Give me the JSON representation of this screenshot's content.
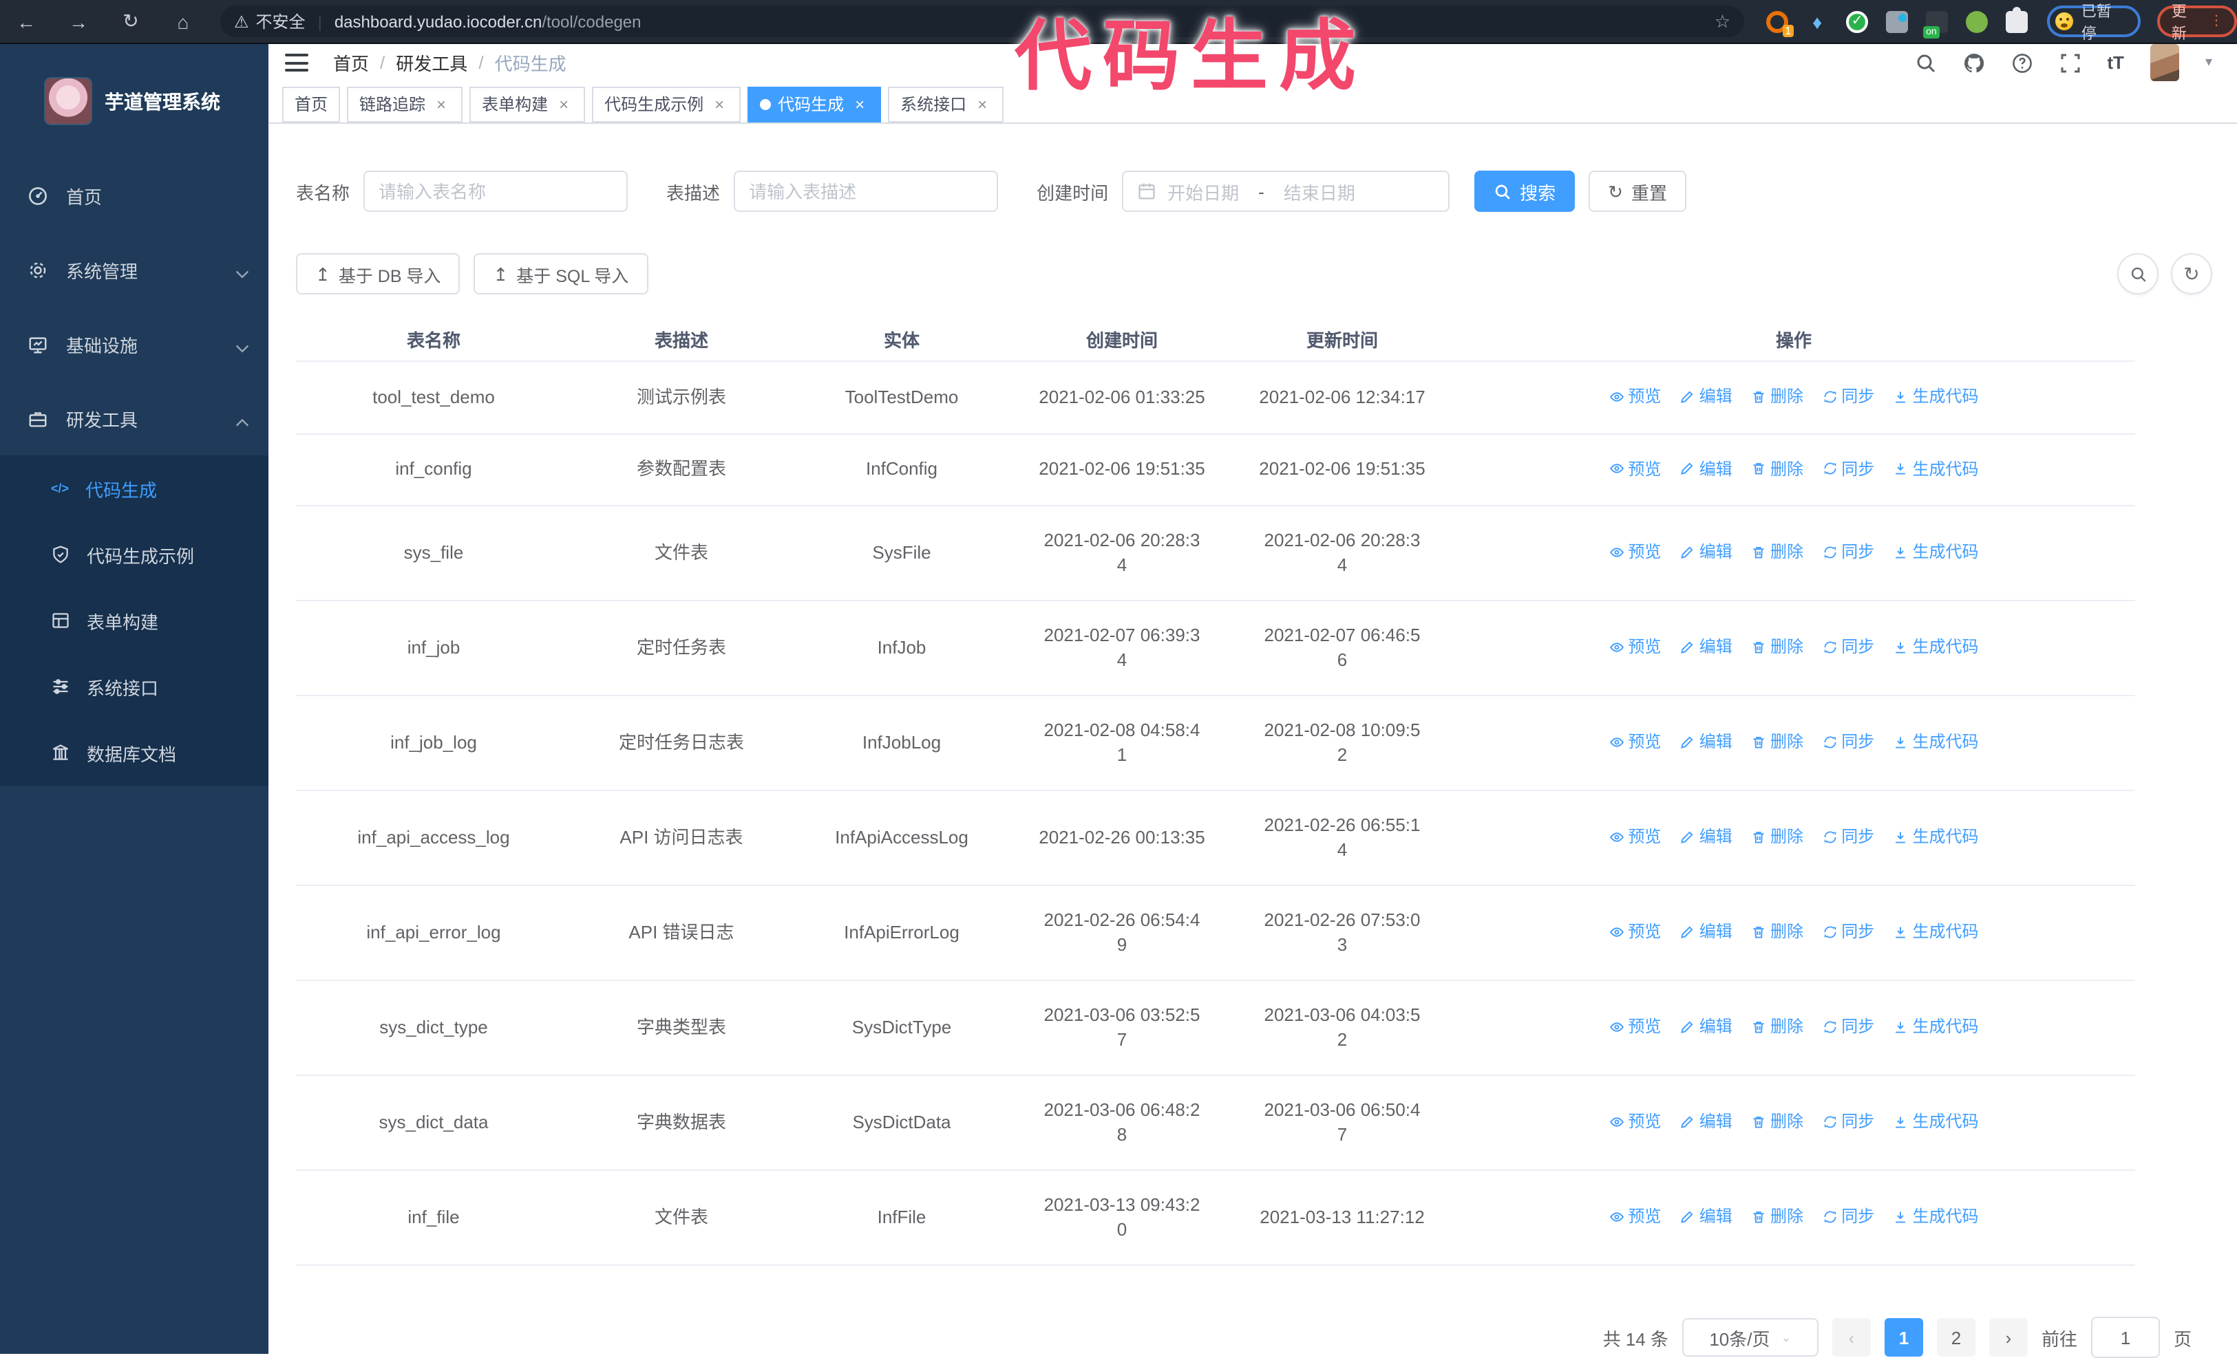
{
  "watermark": "代码生成",
  "browser": {
    "security_label": "不安全",
    "url_host": "dashboard.yudao.iocoder.cn",
    "url_path": "/tool/codegen",
    "paused_badge": "已暂停",
    "update_button": "更新",
    "extension_badge": "1",
    "extension_on_badge": "on"
  },
  "icons": {
    "back": "←",
    "forward": "→",
    "reload": "↻",
    "home": "⌂",
    "warning": "⚠",
    "star": "☆",
    "divider": "|",
    "gem": "♦",
    "check": "✓",
    "caret_down": "▾",
    "select_caret": "⌄",
    "font_size": "tT",
    "code": "</>",
    "import": "↥",
    "reset": "↻",
    "close": "×",
    "breadcrumb_sep": "/",
    "prev": "‹",
    "next": "›",
    "update_dots": "⋮"
  },
  "sidebar": {
    "title": "芋道管理系统",
    "items": [
      {
        "label": "首页"
      },
      {
        "label": "系统管理"
      },
      {
        "label": "基础设施"
      },
      {
        "label": "研发工具"
      }
    ],
    "subitems": [
      {
        "label": "代码生成"
      },
      {
        "label": "代码生成示例"
      },
      {
        "label": "表单构建"
      },
      {
        "label": "系统接口"
      },
      {
        "label": "数据库文档"
      }
    ]
  },
  "header": {
    "breadcrumb": [
      "首页",
      "研发工具",
      "代码生成"
    ]
  },
  "tabs": [
    {
      "label": "首页"
    },
    {
      "label": "链路追踪"
    },
    {
      "label": "表单构建"
    },
    {
      "label": "代码生成示例"
    },
    {
      "label": "代码生成"
    },
    {
      "label": "系统接口"
    }
  ],
  "filters": {
    "table_name_label": "表名称",
    "table_name_placeholder": "请输入表名称",
    "table_desc_label": "表描述",
    "table_desc_placeholder": "请输入表描述",
    "create_time_label": "创建时间",
    "date_start_placeholder": "开始日期",
    "date_separator": "-",
    "date_end_placeholder": "结束日期",
    "search_button": "搜索",
    "reset_button": "重置"
  },
  "toolbar": {
    "import_db_button": "基于 DB 导入",
    "import_sql_button": "基于 SQL 导入"
  },
  "table": {
    "columns": [
      "表名称",
      "表描述",
      "实体",
      "创建时间",
      "更新时间",
      "操作"
    ],
    "actions": [
      "预览",
      "编辑",
      "删除",
      "同步",
      "生成代码"
    ],
    "rows": [
      {
        "name": "tool_test_demo",
        "desc": "测试示例表",
        "entity": "ToolTestDemo",
        "create_time": "2021-02-06 01:33:25",
        "update_time": "2021-02-06 12:34:17"
      },
      {
        "name": "inf_config",
        "desc": "参数配置表",
        "entity": "InfConfig",
        "create_time": "2021-02-06 19:51:35",
        "update_time": "2021-02-06 19:51:35"
      },
      {
        "name": "sys_file",
        "desc": "文件表",
        "entity": "SysFile",
        "create_time": "2021-02-06 20:28:3\n4",
        "update_time": "2021-02-06 20:28:3\n4"
      },
      {
        "name": "inf_job",
        "desc": "定时任务表",
        "entity": "InfJob",
        "create_time": "2021-02-07 06:39:3\n4",
        "update_time": "2021-02-07 06:46:5\n6"
      },
      {
        "name": "inf_job_log",
        "desc": "定时任务日志表",
        "entity": "InfJobLog",
        "create_time": "2021-02-08 04:58:4\n1",
        "update_time": "2021-02-08 10:09:5\n2"
      },
      {
        "name": "inf_api_access_log",
        "desc": "API 访问日志表",
        "entity": "InfApiAccessLog",
        "create_time": "2021-02-26 00:13:35",
        "update_time": "2021-02-26 06:55:1\n4"
      },
      {
        "name": "inf_api_error_log",
        "desc": "API 错误日志",
        "entity": "InfApiErrorLog",
        "create_time": "2021-02-26 06:54:4\n9",
        "update_time": "2021-02-26 07:53:0\n3"
      },
      {
        "name": "sys_dict_type",
        "desc": "字典类型表",
        "entity": "SysDictType",
        "create_time": "2021-03-06 03:52:5\n7",
        "update_time": "2021-03-06 04:03:5\n2"
      },
      {
        "name": "sys_dict_data",
        "desc": "字典数据表",
        "entity": "SysDictData",
        "create_time": "2021-03-06 06:48:2\n8",
        "update_time": "2021-03-06 06:50:4\n7"
      },
      {
        "name": "inf_file",
        "desc": "文件表",
        "entity": "InfFile",
        "create_time": "2021-03-13 09:43:2\n0",
        "update_time": "2021-03-13 11:27:12"
      }
    ]
  },
  "pagination": {
    "total_text": "共 14 条",
    "page_size": "10条/页",
    "pages": [
      "1",
      "2"
    ],
    "goto_label": "前往",
    "goto_value": "1",
    "goto_suffix": "页"
  },
  "colors": {
    "accent_blue": "#409eff",
    "sidebar_bg": "#1f3b59",
    "sidebar_sub_bg": "#16304d",
    "watermark_pink": "#f3476c",
    "browser_bar": "#232b36"
  }
}
